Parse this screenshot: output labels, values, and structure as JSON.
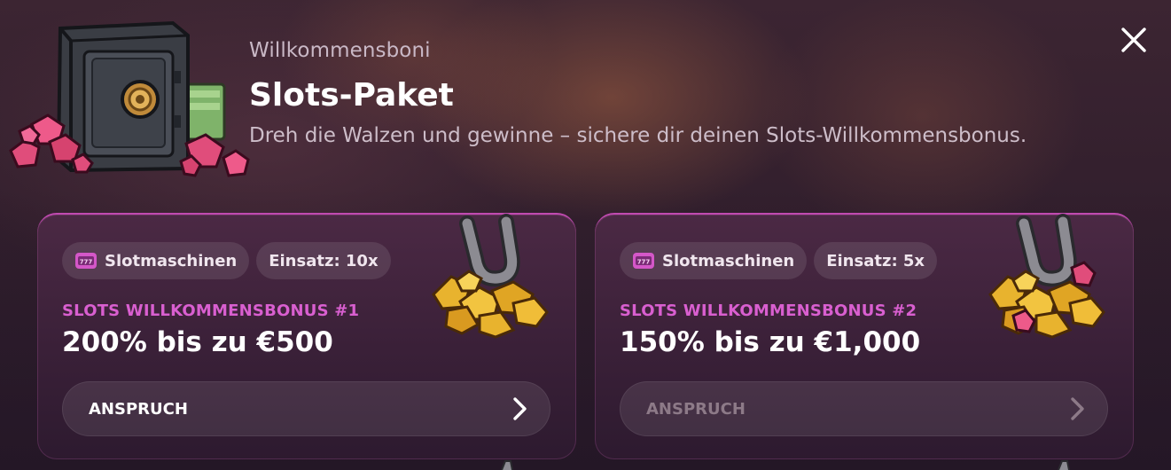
{
  "header": {
    "eyebrow": "Willkommensboni",
    "title": "Slots-Paket",
    "subtitle": "Dreh die Walzen und gewinne – sichere dir deinen Slots-Willkommensbonus."
  },
  "close": {
    "icon": "close-icon"
  },
  "colors": {
    "accent_pink": "#d95fd0",
    "card_border": "#c04ab0",
    "background": "#2a1a26"
  },
  "cards": [
    {
      "category_icon": "slot-machine-icon",
      "category": "Slotmaschinen",
      "wager": "Einsatz: 10x",
      "label": "SLOTS WILLKOMMENSBONUS #1",
      "amount": "200% bis zu €500",
      "cta": "ANSPRUCH",
      "cta_icon": "chevron-right-icon",
      "illustration": "horseshoe-gold-icon"
    },
    {
      "category_icon": "slot-machine-icon",
      "category": "Slotmaschinen",
      "wager": "Einsatz: 5x",
      "label": "SLOTS WILLKOMMENSBONUS #2",
      "amount": "150% bis zu €1,000",
      "cta": "ANSPRUCH",
      "cta_icon": "chevron-right-icon",
      "illustration": "horseshoe-gold-gems-icon"
    }
  ]
}
